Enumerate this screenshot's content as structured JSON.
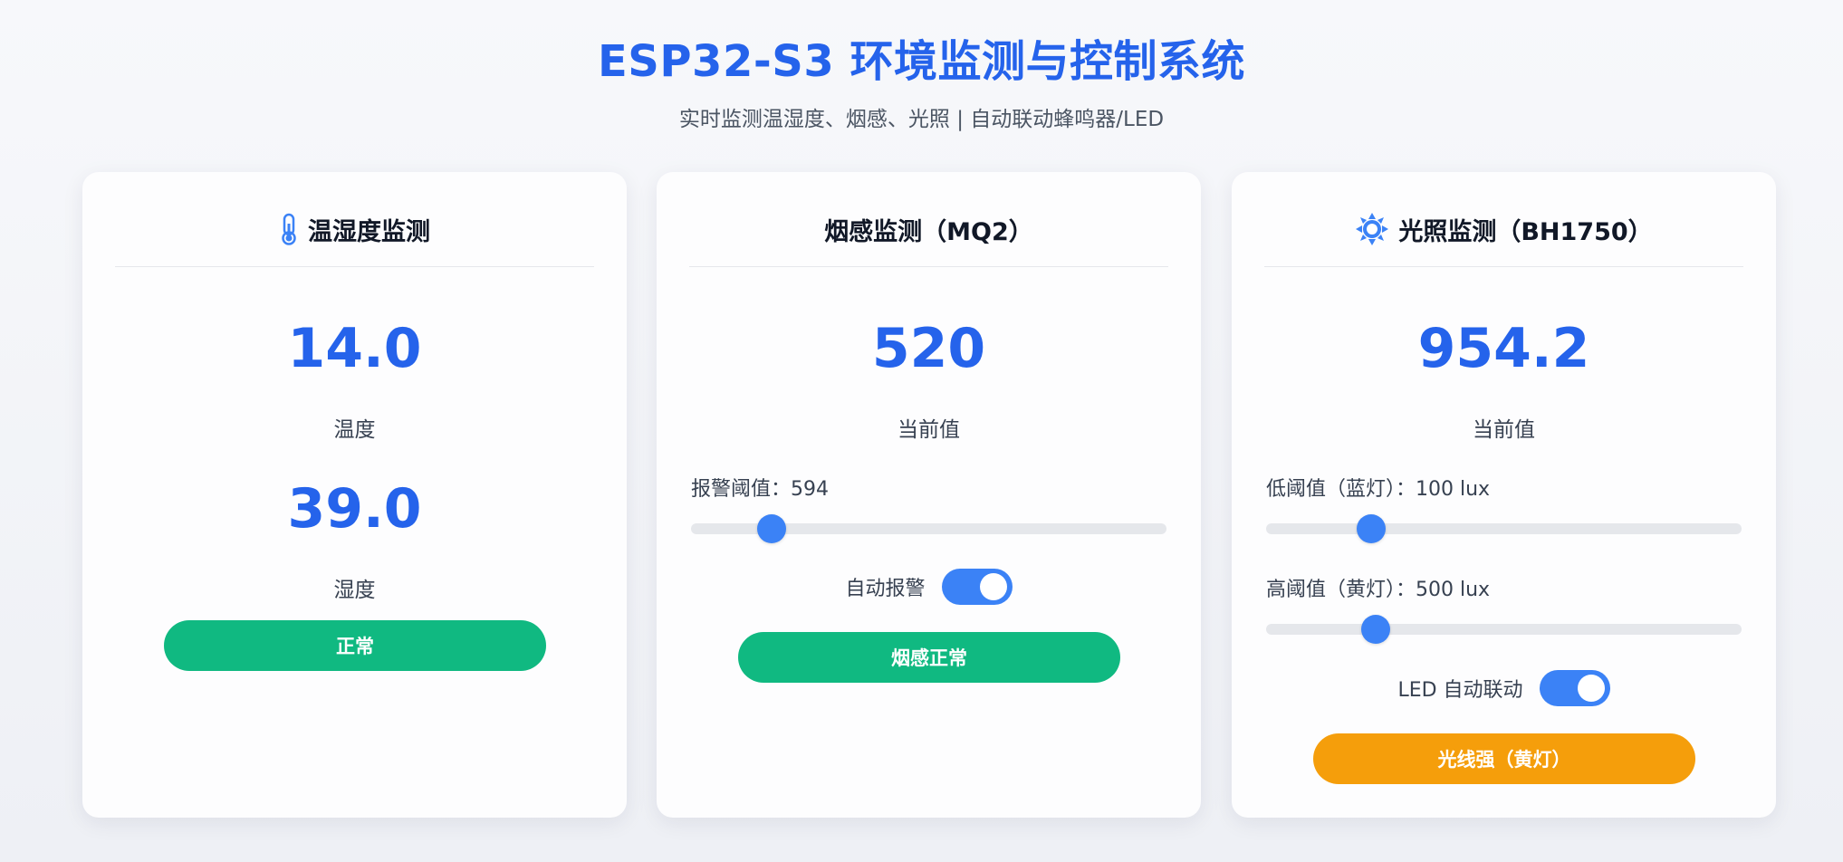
{
  "header": {
    "title": "ESP32-S3 环境监测与控制系统",
    "subtitle": "实时监测温湿度、烟感、光照 | 自动联动蜂鸣器/LED"
  },
  "colors": {
    "accent": "#2563eb",
    "slider_thumb": "#3b82f6",
    "status_normal": "#10b981",
    "status_warning": "#f59e0b"
  },
  "cards": {
    "temp_humidity": {
      "icon": "thermometer-icon",
      "title": "温湿度监测",
      "temperature_value": "14.0",
      "temperature_label": "温度",
      "humidity_value": "39.0",
      "humidity_label": "湿度",
      "status": "正常"
    },
    "smoke": {
      "title": "烟感监测（MQ2）",
      "value": "520",
      "value_label": "当前值",
      "threshold_label": "报警阈值：594",
      "threshold_slider_fraction": 0.17,
      "auto_alarm_label": "自动报警",
      "auto_alarm_enabled": true,
      "status": "烟感正常"
    },
    "light": {
      "icon": "sun-icon",
      "title": "光照监测（BH1750）",
      "value": "954.2",
      "value_label": "当前值",
      "low_threshold_label": "低阈值（蓝灯）：100 lux",
      "low_slider_fraction": 0.22,
      "high_threshold_label": "高阈值（黄灯）：500 lux",
      "high_slider_fraction": 0.23,
      "led_auto_label": "LED 自动联动",
      "led_auto_enabled": true,
      "status": "光线强（黄灯）"
    }
  }
}
